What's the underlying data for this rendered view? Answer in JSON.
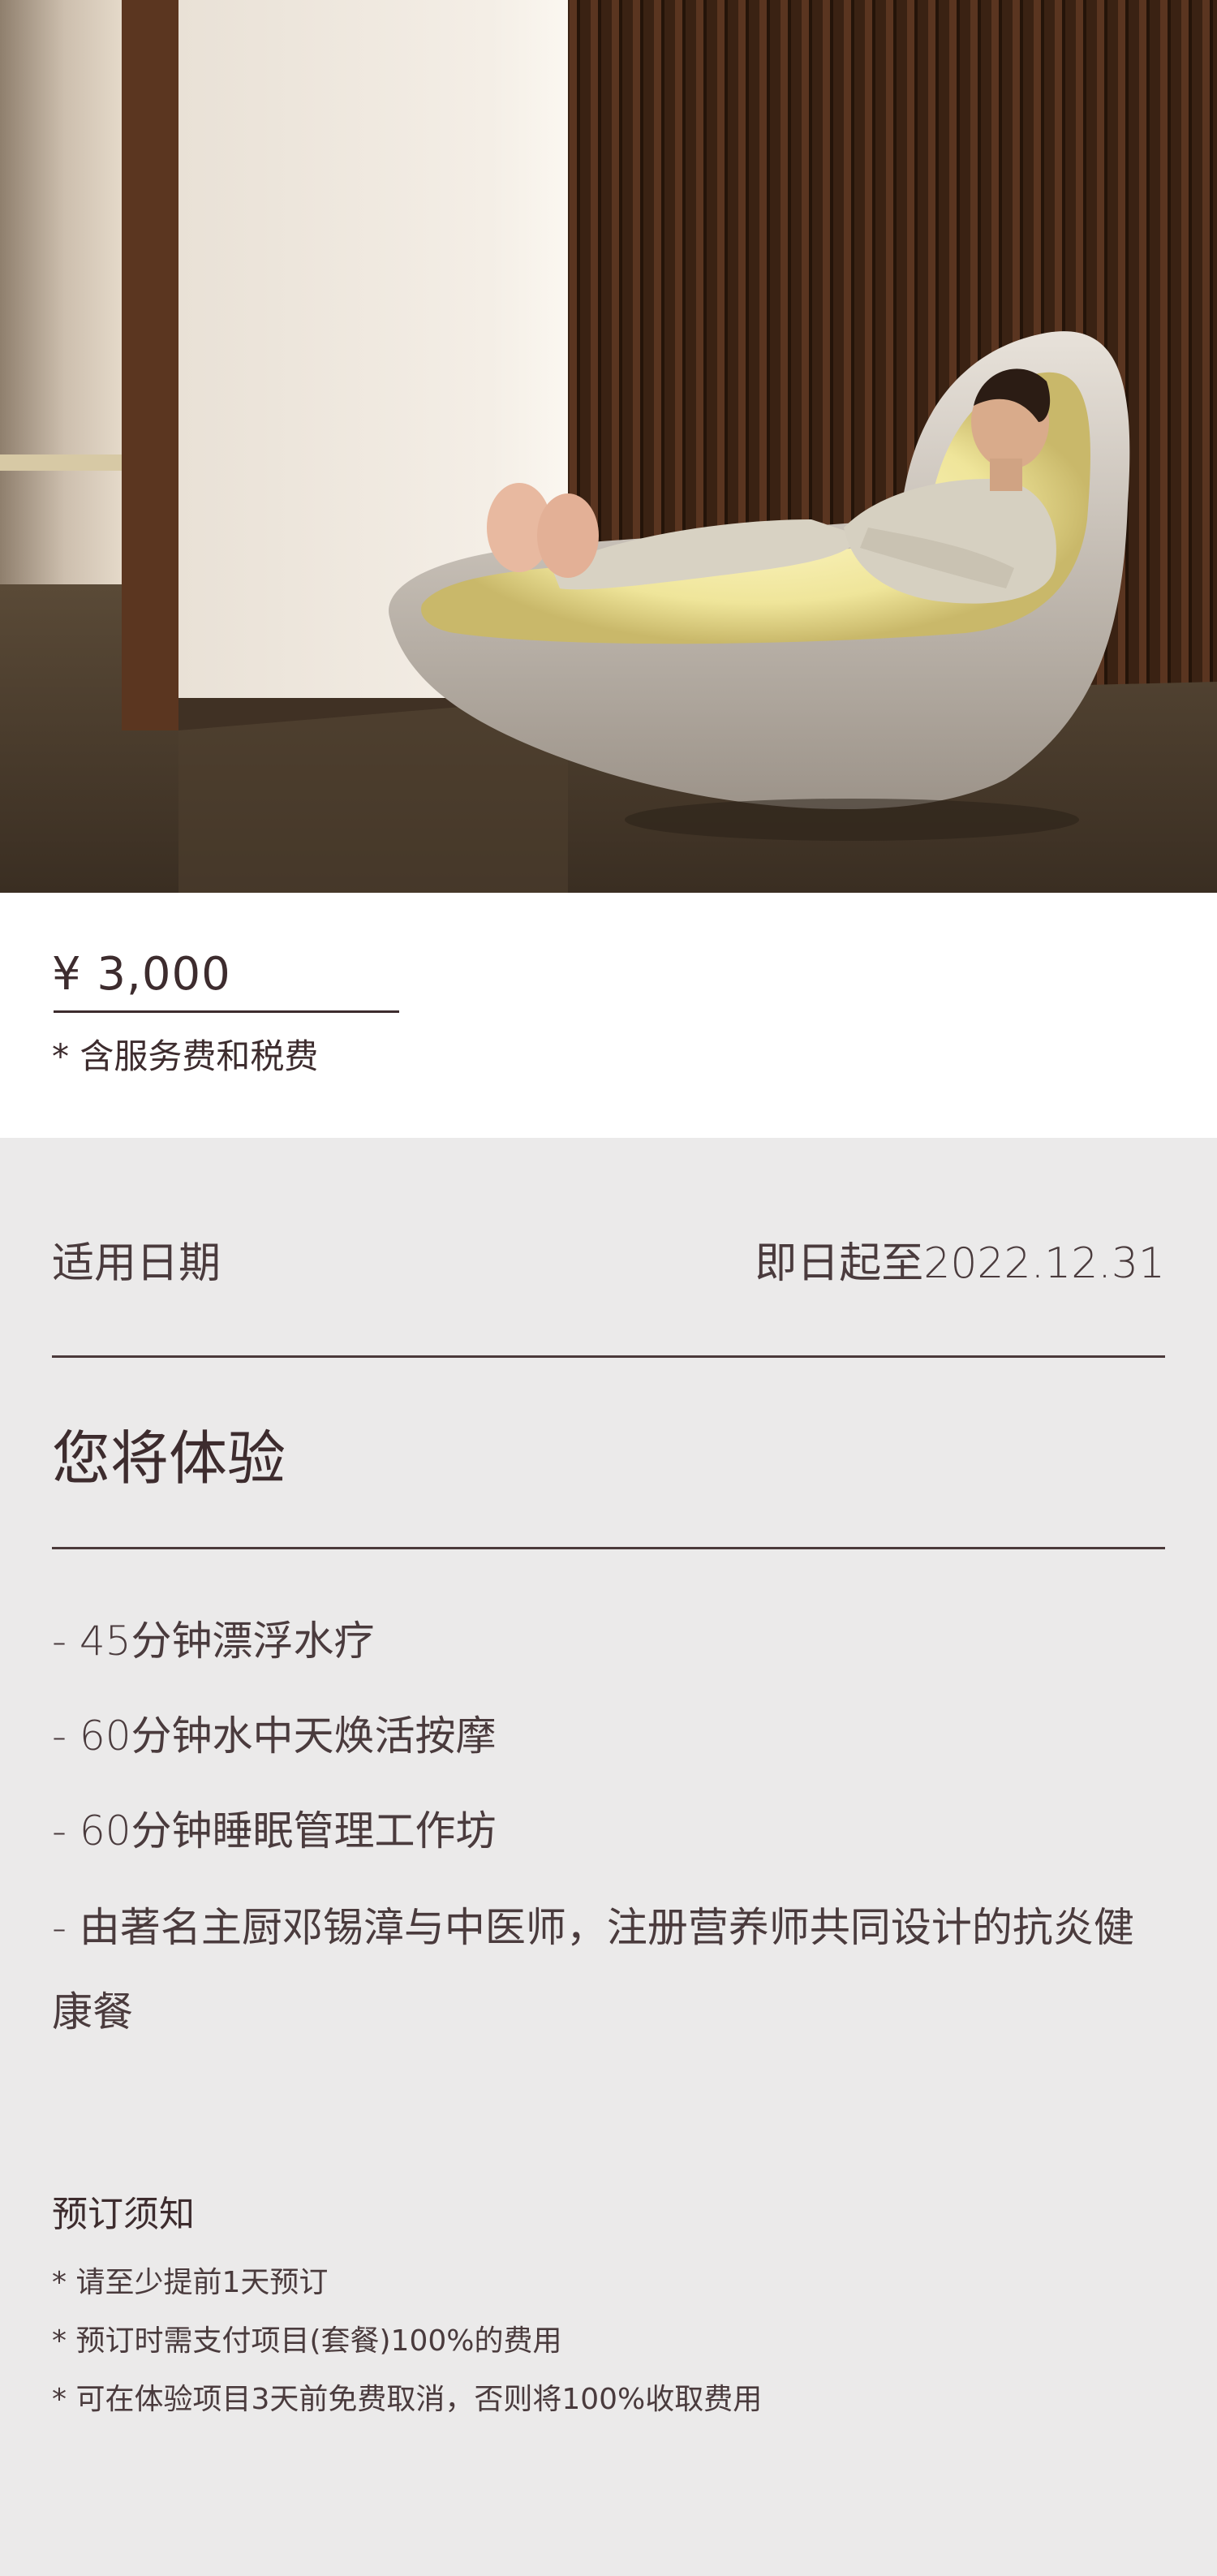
{
  "hero": {
    "image_description_icon": "float-pod-photo"
  },
  "price": {
    "amount": "¥ 3,000",
    "note": "* 含服务费和税费"
  },
  "validity": {
    "label": "适用日期",
    "value": "即日起至2022.12.31"
  },
  "experience": {
    "title": "您将体验",
    "items": [
      "- 45分钟漂浮水疗",
      "- 60分钟水中天焕活按摩",
      "- 60分钟睡眠管理工作坊",
      "- 由著名主厨邓锡漳与中医师，注册营养师共同设计的抗炎健康餐"
    ]
  },
  "booking": {
    "title": "预订须知",
    "notes": [
      "* 请至少提前1天预订",
      "* 预订时需支付项目(套餐)100%的费用",
      "* 可在体验项目3天前免费取消，否则将100%收取费用"
    ]
  },
  "colors": {
    "text": "#3d2c2e",
    "rule": "#4b3a3b",
    "background": "#ebeaea",
    "price_background": "#ffffff"
  }
}
